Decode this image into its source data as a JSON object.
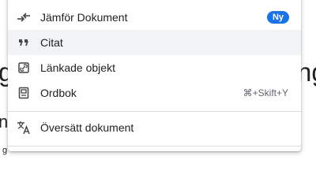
{
  "background": {
    "big_left_fragment": "g",
    "big_right_fragment": "ng",
    "mid_left_fragment": "ni",
    "small_left_fragment": "g"
  },
  "menu": {
    "items": [
      {
        "label": "Jämför Dokument",
        "icon": "compare-arrows-icon",
        "badge": "Ny"
      },
      {
        "label": "Citat",
        "icon": "quote-icon"
      },
      {
        "label": "Länkade objekt",
        "icon": "linked-objects-icon"
      },
      {
        "label": "Ordbok",
        "icon": "dictionary-icon",
        "shortcut": "⌘+Skift+Y"
      },
      {
        "label": "Översätt dokument",
        "icon": "translate-icon"
      }
    ]
  },
  "colors": {
    "badge": "#1a73e8",
    "highlight": "#f1f3f4",
    "divider": "#dadce0",
    "text": "#202124",
    "secondary_text": "#5f6368"
  }
}
